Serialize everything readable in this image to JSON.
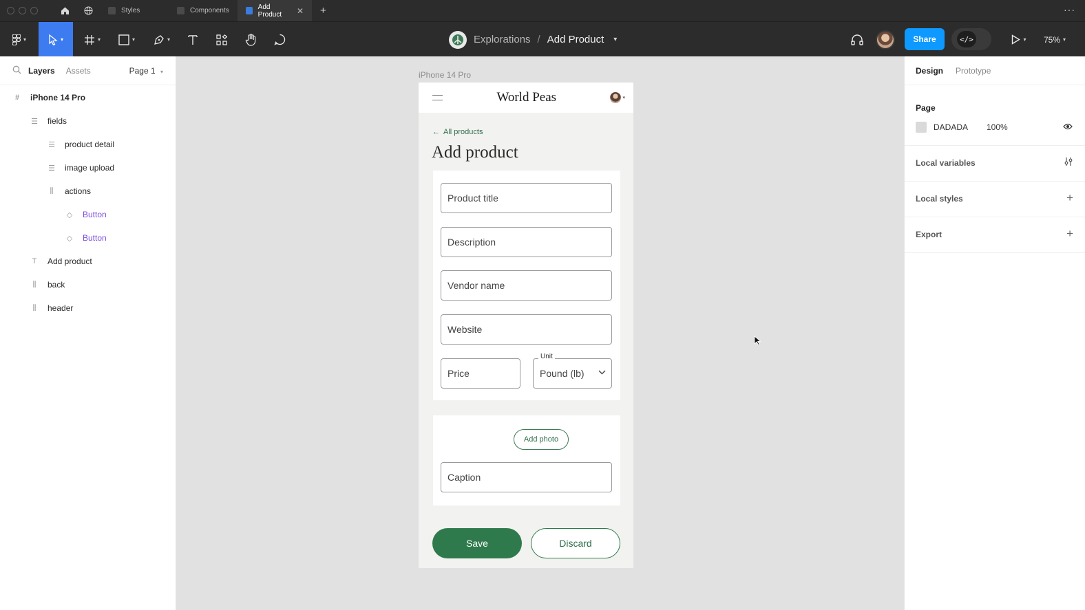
{
  "tabs": [
    {
      "label": "Styles",
      "active": false
    },
    {
      "label": "Components",
      "active": false
    },
    {
      "label": "Add Product",
      "active": true
    }
  ],
  "toolbar": {
    "project": "Explorations",
    "separator": "/",
    "file": "Add Product",
    "share_label": "Share",
    "dev_label": "</>",
    "zoom": "75%"
  },
  "left_panel": {
    "tab_layers": "Layers",
    "tab_assets": "Assets",
    "page_select": "Page 1",
    "layers": [
      {
        "label": "iPhone 14 Pro",
        "icon": "frame-icon"
      },
      {
        "label": "fields",
        "icon": "auto-layout-vertical-icon"
      },
      {
        "label": "product detail",
        "icon": "auto-layout-vertical-icon"
      },
      {
        "label": "image upload",
        "icon": "auto-layout-vertical-icon"
      },
      {
        "label": "actions",
        "icon": "auto-layout-horizontal-icon"
      },
      {
        "label": "Button",
        "icon": "instance-icon"
      },
      {
        "label": "Button",
        "icon": "instance-icon"
      },
      {
        "label": "Add product",
        "icon": "text-icon"
      },
      {
        "label": "back",
        "icon": "auto-layout-horizontal-icon"
      },
      {
        "label": "header",
        "icon": "auto-layout-horizontal-icon"
      }
    ]
  },
  "canvas": {
    "frame_label": "iPhone 14 Pro",
    "app": {
      "brand": "World Peas",
      "back_link": "All products",
      "title": "Add product",
      "fields": {
        "product_title": "Product title",
        "description": "Description",
        "vendor_name": "Vendor name",
        "website": "Website",
        "price": "Price",
        "unit_label": "Unit",
        "unit_value": "Pound (lb)",
        "caption": "Caption"
      },
      "add_photo": "Add photo",
      "save": "Save",
      "discard": "Discard"
    }
  },
  "right_panel": {
    "tab_design": "Design",
    "tab_prototype": "Prototype",
    "page_heading": "Page",
    "page_color": "DADADA",
    "page_opacity": "100%",
    "local_variables": "Local variables",
    "local_styles": "Local styles",
    "export": "Export"
  },
  "colors": {
    "brand_green": "#2f7a4c",
    "accent_blue": "#0d99ff",
    "canvas_bg": "#e1e1e1",
    "page_swatch": "#dadada"
  }
}
